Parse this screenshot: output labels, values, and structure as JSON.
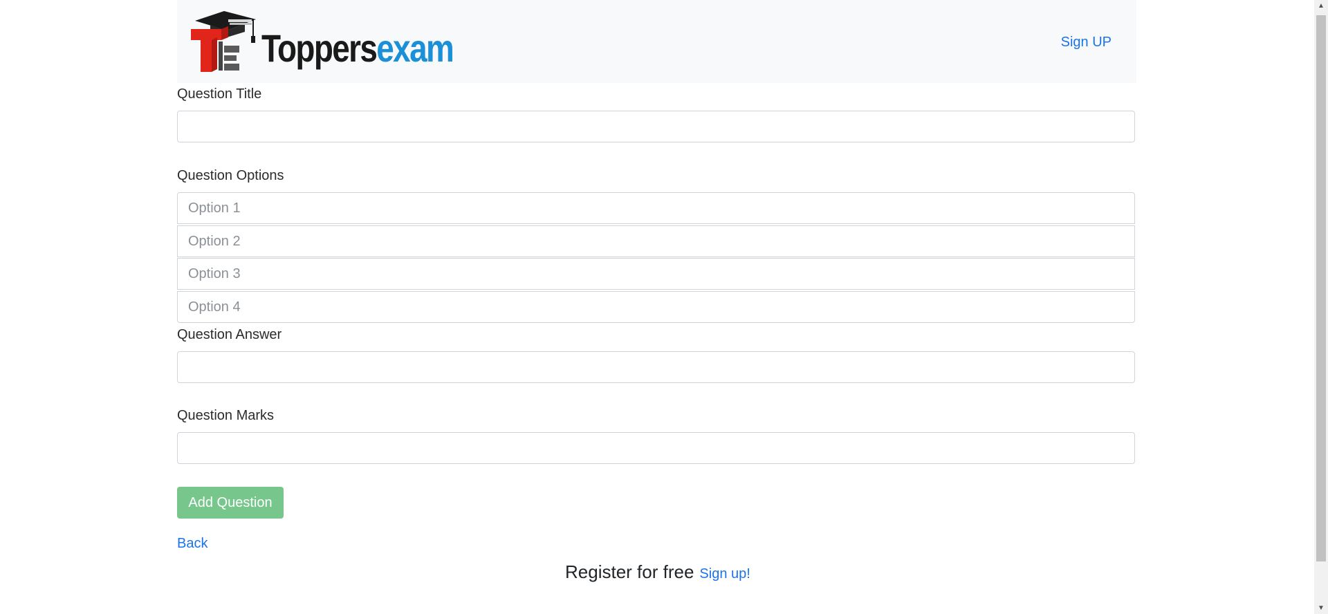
{
  "header": {
    "brand_part1": "Toppers",
    "brand_part2": "exam",
    "signup_label": "Sign UP",
    "logo_icon": "graduation-cap-te-logo"
  },
  "form": {
    "title_label": "Question Title",
    "title_value": "",
    "options_label": "Question Options",
    "options": [
      {
        "placeholder": "Option 1",
        "value": ""
      },
      {
        "placeholder": "Option 2",
        "value": ""
      },
      {
        "placeholder": "Option 3",
        "value": ""
      },
      {
        "placeholder": "Option 4",
        "value": ""
      }
    ],
    "answer_label": "Question Answer",
    "answer_value": "",
    "marks_label": "Question Marks",
    "marks_value": "",
    "submit_label": "Add Question"
  },
  "back_label": "Back",
  "footer": {
    "text": "Register for free",
    "link_label": "Sign up!"
  },
  "colors": {
    "navbar_bg": "#f8f9fa",
    "link": "#1a73e8",
    "brand_dark": "#1a1a1a",
    "brand_blue": "#1b8fd8",
    "logo_red": "#e1251b",
    "button_green": "#77c68c"
  }
}
